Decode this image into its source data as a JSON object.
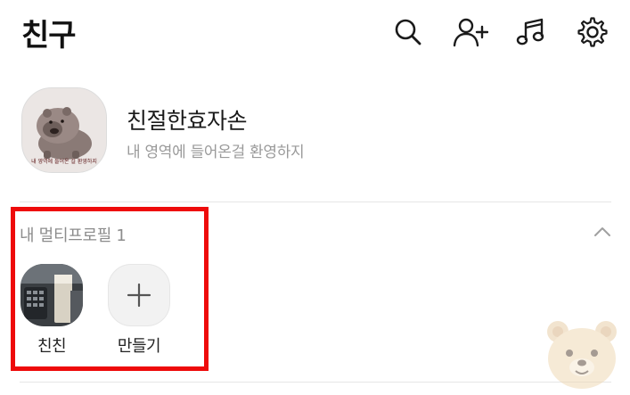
{
  "header": {
    "title": "친구",
    "icons": [
      "search-icon",
      "add-friend-icon",
      "music-icon",
      "settings-icon"
    ]
  },
  "profile": {
    "name": "친절한효자손",
    "status": "내 영역에 들어온걸 환영하지",
    "avatar_caption": "내 영역에 들어온 걸 환영하지"
  },
  "multi_profile": {
    "title": "내 멀티프로필 1",
    "items": [
      {
        "label": "친친"
      },
      {
        "label": "만들기"
      }
    ]
  },
  "colors": {
    "highlight": "#ee0b0b",
    "secondary_text": "#9a9a9a",
    "divider": "#e6e6e6"
  }
}
